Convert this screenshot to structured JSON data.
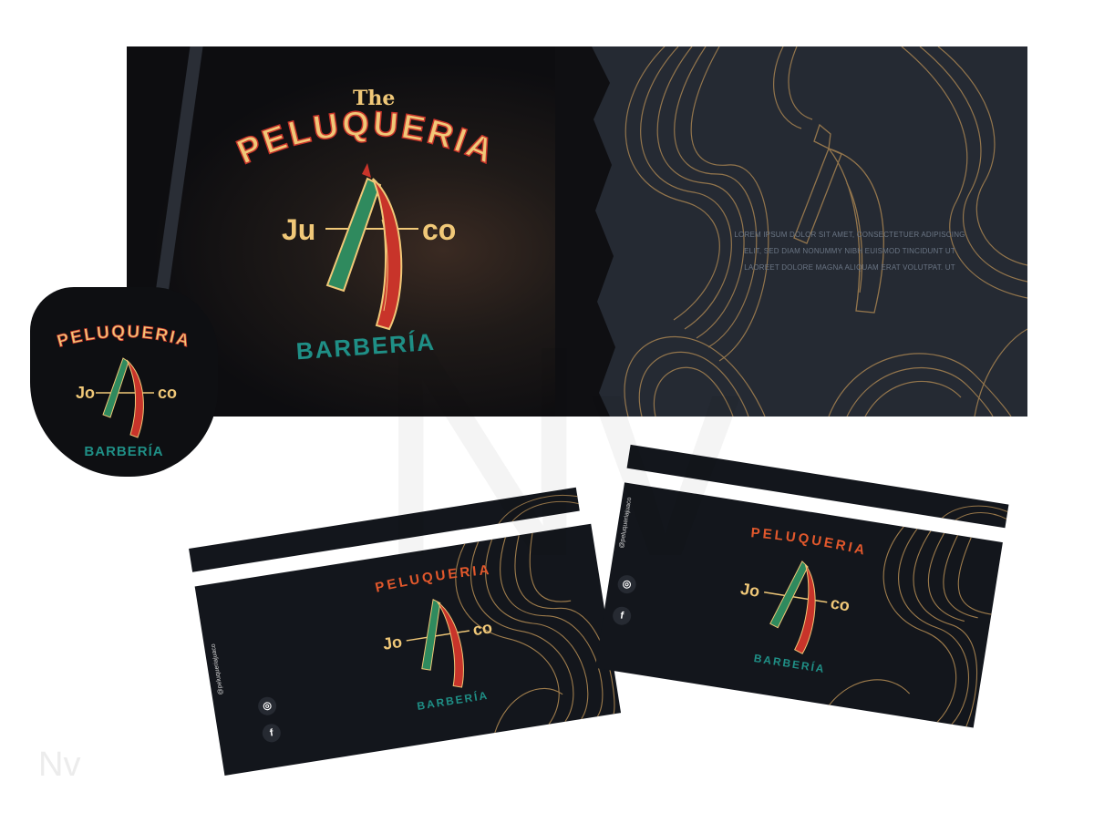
{
  "banner": {
    "title_the": "The",
    "title_peluqueria": "PELUQUERIA",
    "brand_left": "Ju",
    "brand_right": "co",
    "subtitle": "BARBERÍA",
    "lorem_lines": [
      "LOREM IPSUM DOLOR SIT AMET, CONSECTETUER ADIPISCING",
      "ELIT, SED DIAM NONUMMY NIBH EUISMOD TINCIDUNT UT",
      "LAOREET DOLORE MAGNA ALIQUAM ERAT VOLUTPAT. UT"
    ]
  },
  "badge": {
    "title": "PELUQUERIA",
    "brand_left": "Jo",
    "brand_right": "co",
    "subtitle": "BARBERÍA"
  },
  "card_left": {
    "title": "PELUQUERIA",
    "brand_left": "Jo",
    "brand_right": "co",
    "subtitle": "BARBERÍA",
    "handle": "@peluqueriajuaco",
    "instagram_icon": "instagram-icon",
    "facebook_icon": "facebook-icon"
  },
  "card_right": {
    "title": "PELUQUERIA",
    "brand_left": "Jo",
    "brand_right": "co",
    "subtitle": "BARBERÍA",
    "handle": "@peluqueriajuaco",
    "instagram_icon": "instagram-icon",
    "facebook_icon": "facebook-icon"
  },
  "watermark": "Nv",
  "colors": {
    "dark": "#13161c",
    "gold": "#f0c878",
    "orange": "#e2582c",
    "teal": "#1f8f86",
    "razor_red": "#c8342a",
    "razor_green": "#2f8a5e",
    "pattern_gold": "#b88f55"
  }
}
